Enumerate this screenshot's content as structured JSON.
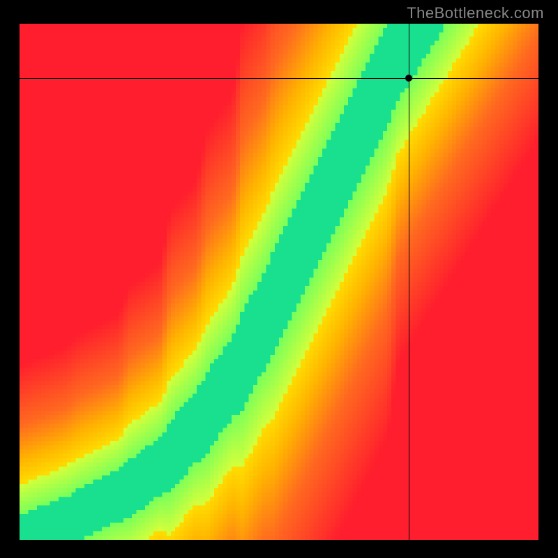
{
  "watermark": "TheBottleneck.com",
  "chart_data": {
    "type": "heatmap",
    "title": "",
    "xlabel": "",
    "ylabel": "",
    "xlim": [
      0,
      1
    ],
    "ylim": [
      0,
      1
    ],
    "grid_size": 120,
    "colorscale": [
      {
        "stop": 0.0,
        "color": "#ff1e2d"
      },
      {
        "stop": 0.35,
        "color": "#ff6a1f"
      },
      {
        "stop": 0.55,
        "color": "#ffb400"
      },
      {
        "stop": 0.72,
        "color": "#ffe600"
      },
      {
        "stop": 0.85,
        "color": "#d4ff3a"
      },
      {
        "stop": 0.93,
        "color": "#7aff5a"
      },
      {
        "stop": 1.0,
        "color": "#18e08e"
      }
    ],
    "ridge": {
      "description": "center of green optimal band as y(x) in normalized [0,1] coords, lower-left origin",
      "points": [
        {
          "x": 0.0,
          "y": 0.0
        },
        {
          "x": 0.1,
          "y": 0.04
        },
        {
          "x": 0.2,
          "y": 0.09
        },
        {
          "x": 0.28,
          "y": 0.15
        },
        {
          "x": 0.35,
          "y": 0.23
        },
        {
          "x": 0.42,
          "y": 0.33
        },
        {
          "x": 0.48,
          "y": 0.44
        },
        {
          "x": 0.54,
          "y": 0.56
        },
        {
          "x": 0.6,
          "y": 0.68
        },
        {
          "x": 0.66,
          "y": 0.8
        },
        {
          "x": 0.72,
          "y": 0.92
        },
        {
          "x": 0.77,
          "y": 1.0
        }
      ],
      "half_width": 0.045
    },
    "crosshair": {
      "x": 0.75,
      "y": 0.895
    },
    "marker": {
      "x": 0.75,
      "y": 0.895
    }
  }
}
